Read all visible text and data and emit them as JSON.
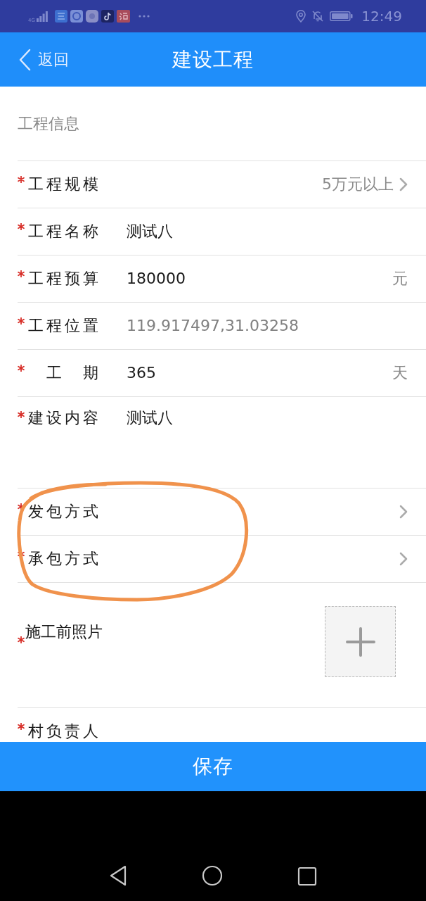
{
  "status_bar": {
    "network": "4G",
    "time": "12:49"
  },
  "header": {
    "back": "返回",
    "title": "建设工程"
  },
  "section": {
    "title": "工程信息"
  },
  "rows": [
    {
      "kind": "picker",
      "label": "工程规模",
      "required": true,
      "value": "5万元以上"
    },
    {
      "kind": "text",
      "label": "工程名称",
      "required": true,
      "value": "测试八",
      "disabled": false
    },
    {
      "kind": "text",
      "label": "工程预算",
      "required": true,
      "value": "180000",
      "unit": "元",
      "disabled": false
    },
    {
      "kind": "text",
      "label": "工程位置",
      "required": true,
      "value": "119.917497,31.03258",
      "disabled": true
    },
    {
      "kind": "text",
      "label": "工　期",
      "required": true,
      "value": "365",
      "unit": "天",
      "disabled": false
    },
    {
      "kind": "textarea",
      "label": "建设内容",
      "required": true,
      "value": "测试八",
      "disabled": false
    },
    {
      "kind": "picker",
      "label": "发包方式",
      "required": true
    },
    {
      "kind": "picker",
      "label": "承包方式",
      "required": true
    },
    {
      "kind": "photo",
      "label": "施工前照片",
      "required": true
    },
    {
      "kind": "text",
      "label": "村负责人",
      "required": true
    }
  ],
  "save_button": "保存"
}
